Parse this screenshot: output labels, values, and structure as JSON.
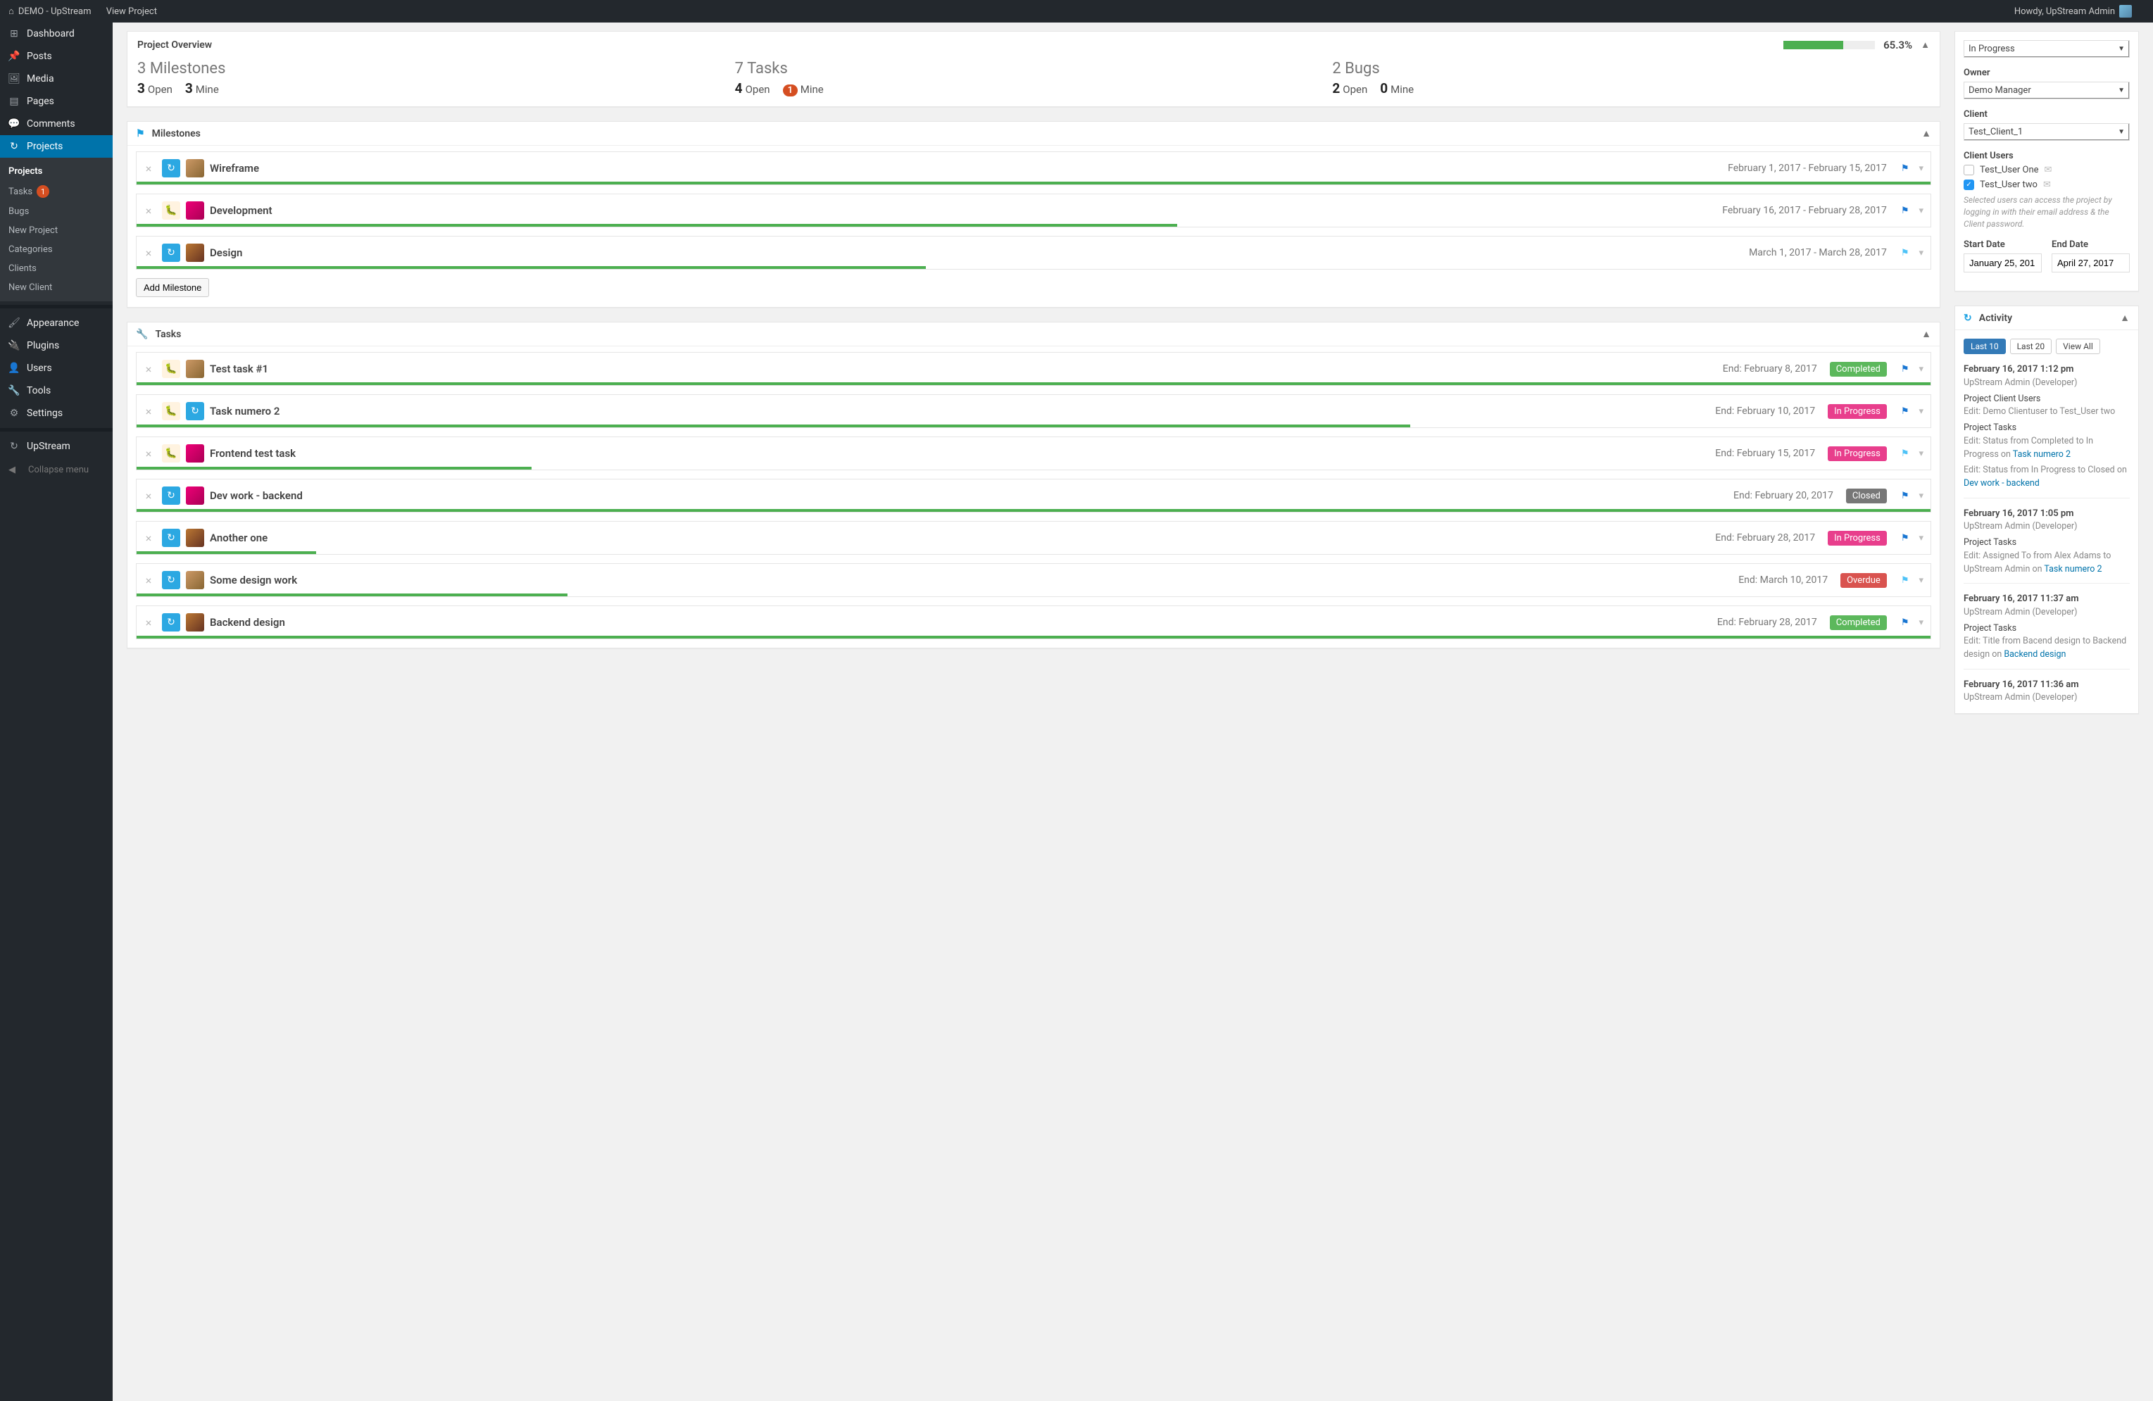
{
  "topbar": {
    "site": "DEMO - UpStream",
    "view_project": "View Project",
    "howdy": "Howdy, UpStream Admin"
  },
  "sidebar": {
    "items": [
      {
        "icon": "dashboard-icon",
        "label": "Dashboard"
      },
      {
        "icon": "pin-icon",
        "label": "Posts"
      },
      {
        "icon": "media-icon",
        "label": "Media"
      },
      {
        "icon": "pages-icon",
        "label": "Pages"
      },
      {
        "icon": "comments-icon",
        "label": "Comments"
      },
      {
        "icon": "upstream-icon",
        "label": "Projects",
        "active": true
      }
    ],
    "submenu": {
      "projects": "Projects",
      "tasks": "Tasks",
      "tasks_badge": "1",
      "bugs": "Bugs",
      "new_project": "New Project",
      "categories": "Categories",
      "clients": "Clients",
      "new_client": "New Client"
    },
    "items2": [
      {
        "icon": "brush-icon",
        "label": "Appearance"
      },
      {
        "icon": "plug-icon",
        "label": "Plugins"
      },
      {
        "icon": "users-icon",
        "label": "Users"
      },
      {
        "icon": "wrench-icon",
        "label": "Tools"
      },
      {
        "icon": "settings-icon",
        "label": "Settings"
      }
    ],
    "upstream": "UpStream",
    "collapse": "Collapse menu"
  },
  "overview": {
    "title": "Project Overview",
    "pct": "65.3%",
    "progress": 65.3,
    "milestones": {
      "big": "3 Milestones",
      "open_n": "3",
      "open_l": "Open",
      "mine_n": "3",
      "mine_l": "Mine"
    },
    "tasks": {
      "big": "7 Tasks",
      "open_n": "4",
      "open_l": "Open",
      "mine_n": "1",
      "mine_l": "Mine",
      "mine_badge": true
    },
    "bugs": {
      "big": "2 Bugs",
      "open_n": "2",
      "open_l": "Open",
      "mine_n": "0",
      "mine_l": "Mine"
    }
  },
  "milestones": {
    "heading": "Milestones",
    "add_label": "Add Milestone",
    "items": [
      {
        "title": "Wireframe",
        "dates": "February 1, 2017 - February 15, 2017",
        "flag": "blue",
        "icons": [
          "upstream",
          "avatar"
        ],
        "prog": 100
      },
      {
        "title": "Development",
        "dates": "February 16, 2017 - February 28, 2017",
        "flag": "blue",
        "icons": [
          "bug",
          "avatar2"
        ],
        "prog": 58
      },
      {
        "title": "Design",
        "dates": "March 1, 2017 - March 28, 2017",
        "flag": "cyan",
        "icons": [
          "upstream",
          "avatar3"
        ],
        "prog": 44
      }
    ]
  },
  "tasks": {
    "heading": "Tasks",
    "items": [
      {
        "title": "Test task #1",
        "end": "End: February 8, 2017",
        "status": "Completed",
        "stclass": "st-completed",
        "flag": "blue",
        "icons": [
          "bug",
          "avatar"
        ],
        "prog": 100
      },
      {
        "title": "Task numero 2",
        "end": "End: February 10, 2017",
        "status": "In Progress",
        "stclass": "st-inprogress",
        "flag": "blue",
        "icons": [
          "bug",
          "upstream"
        ],
        "prog": 71
      },
      {
        "title": "Frontend test task",
        "end": "End: February 15, 2017",
        "status": "In Progress",
        "stclass": "st-inprogress",
        "flag": "cyan",
        "icons": [
          "bug",
          "avatar2"
        ],
        "prog": 22
      },
      {
        "title": "Dev work - backend",
        "end": "End: February 20, 2017",
        "status": "Closed",
        "stclass": "st-closed",
        "flag": "blue",
        "icons": [
          "upstream",
          "avatar2"
        ],
        "prog": 100
      },
      {
        "title": "Another one",
        "end": "End: February 28, 2017",
        "status": "In Progress",
        "stclass": "st-inprogress",
        "flag": "blue",
        "icons": [
          "upstream",
          "avatar3"
        ],
        "prog": 10
      },
      {
        "title": "Some design work",
        "end": "End: March 10, 2017",
        "status": "Overdue",
        "stclass": "st-overdue",
        "flag": "cyan",
        "icons": [
          "upstream",
          "avatar"
        ],
        "prog": 24
      },
      {
        "title": "Backend design",
        "end": "End: February 28, 2017",
        "status": "Completed",
        "stclass": "st-completed",
        "flag": "blue",
        "icons": [
          "upstream",
          "avatar3"
        ],
        "prog": 100
      }
    ]
  },
  "details": {
    "status_value": "In Progress",
    "owner_label": "Owner",
    "owner_value": "Demo Manager",
    "client_label": "Client",
    "client_value": "Test_Client_1",
    "client_users_label": "Client Users",
    "users": [
      {
        "checked": false,
        "name": "Test_User One"
      },
      {
        "checked": true,
        "name": "Test_User two"
      }
    ],
    "hint": "Selected users can access the project by logging in with their email address & the Client password.",
    "start_label": "Start Date",
    "start_value": "January 25, 201",
    "end_label": "End Date",
    "end_value": "April 27, 2017"
  },
  "activity": {
    "heading": "Activity",
    "filters": {
      "last10": "Last 10",
      "last20": "Last 20",
      "viewall": "View All"
    },
    "entries": [
      {
        "date": "February 16, 2017 1:12 pm",
        "who": "UpStream Admin (Developer)",
        "lines": [
          {
            "h": "Project Client Users",
            "t": "Edit: Demo Clientuser to Test_User two"
          },
          {
            "h": "Project Tasks",
            "t": "Edit: Status from Completed to In Progress on ",
            "link": "Task numero 2",
            "t2": ""
          },
          {
            "t": "Edit: Status from In Progress to Closed on ",
            "link": "Dev work - backend"
          }
        ]
      },
      {
        "date": "February 16, 2017 1:05 pm",
        "who": "UpStream Admin (Developer)",
        "lines": [
          {
            "h": "Project Tasks",
            "t": "Edit: Assigned To from Alex Adams to UpStream Admin on ",
            "link": "Task numero 2"
          }
        ]
      },
      {
        "date": "February 16, 2017 11:37 am",
        "who": "UpStream Admin (Developer)",
        "lines": [
          {
            "h": "Project Tasks",
            "t": "Edit: Title from Bacend design to Backend design on ",
            "link": "Backend design"
          }
        ]
      },
      {
        "date": "February 16, 2017 11:36 am",
        "who": "UpStream Admin (Developer)",
        "lines": []
      }
    ]
  }
}
